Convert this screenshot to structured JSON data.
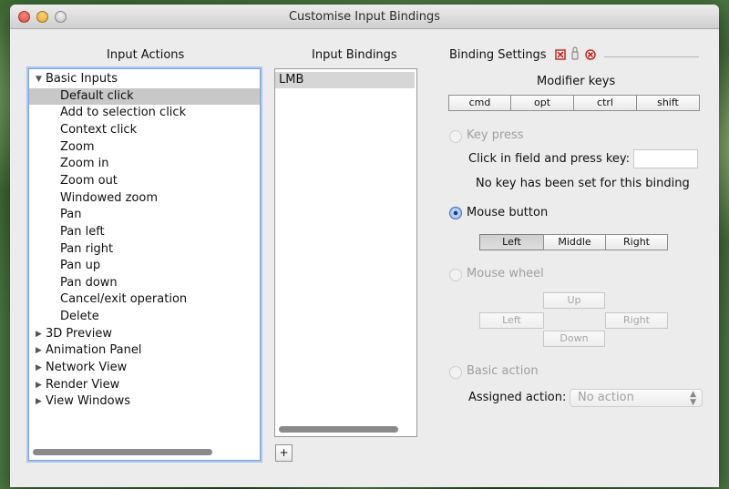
{
  "window": {
    "title": "Customise Input Bindings"
  },
  "actions": {
    "header": "Input Actions",
    "items": [
      {
        "label": "Basic Inputs",
        "expanded": true
      },
      {
        "label": "Default click",
        "selected": true
      },
      {
        "label": "Add to selection click"
      },
      {
        "label": "Context click"
      },
      {
        "label": "Zoom"
      },
      {
        "label": "Zoom in"
      },
      {
        "label": "Zoom out"
      },
      {
        "label": "Windowed zoom"
      },
      {
        "label": "Pan"
      },
      {
        "label": "Pan left"
      },
      {
        "label": "Pan right"
      },
      {
        "label": "Pan up"
      },
      {
        "label": "Pan down"
      },
      {
        "label": "Cancel/exit operation"
      },
      {
        "label": "Delete"
      },
      {
        "label": "3D Preview",
        "expanded": false
      },
      {
        "label": "Animation Panel",
        "expanded": false
      },
      {
        "label": "Network View",
        "expanded": false
      },
      {
        "label": "Render View",
        "expanded": false
      },
      {
        "label": "View Windows",
        "expanded": false
      }
    ]
  },
  "bindings": {
    "header": "Input Bindings",
    "items": [
      "LMB"
    ],
    "add_label": "+"
  },
  "settings": {
    "header": "Binding Settings",
    "modifier_header": "Modifier keys",
    "modifiers": [
      "cmd",
      "opt",
      "ctrl",
      "shift"
    ],
    "key_press": {
      "label": "Key press",
      "instruction": "Click in field and press key:",
      "status": "No key has been set for this binding",
      "value": ""
    },
    "mouse_button": {
      "label": "Mouse button",
      "options": [
        "Left",
        "Middle",
        "Right"
      ],
      "selected": "Left"
    },
    "mouse_wheel": {
      "label": "Mouse wheel",
      "up": "Up",
      "left": "Left",
      "right": "Right",
      "down": "Down"
    },
    "basic_action": {
      "label": "Basic action",
      "assigned_label": "Assigned action:",
      "assigned_value": "No action"
    },
    "icons": [
      "delete-red-icon",
      "lock-icon",
      "clear-red-icon"
    ]
  }
}
